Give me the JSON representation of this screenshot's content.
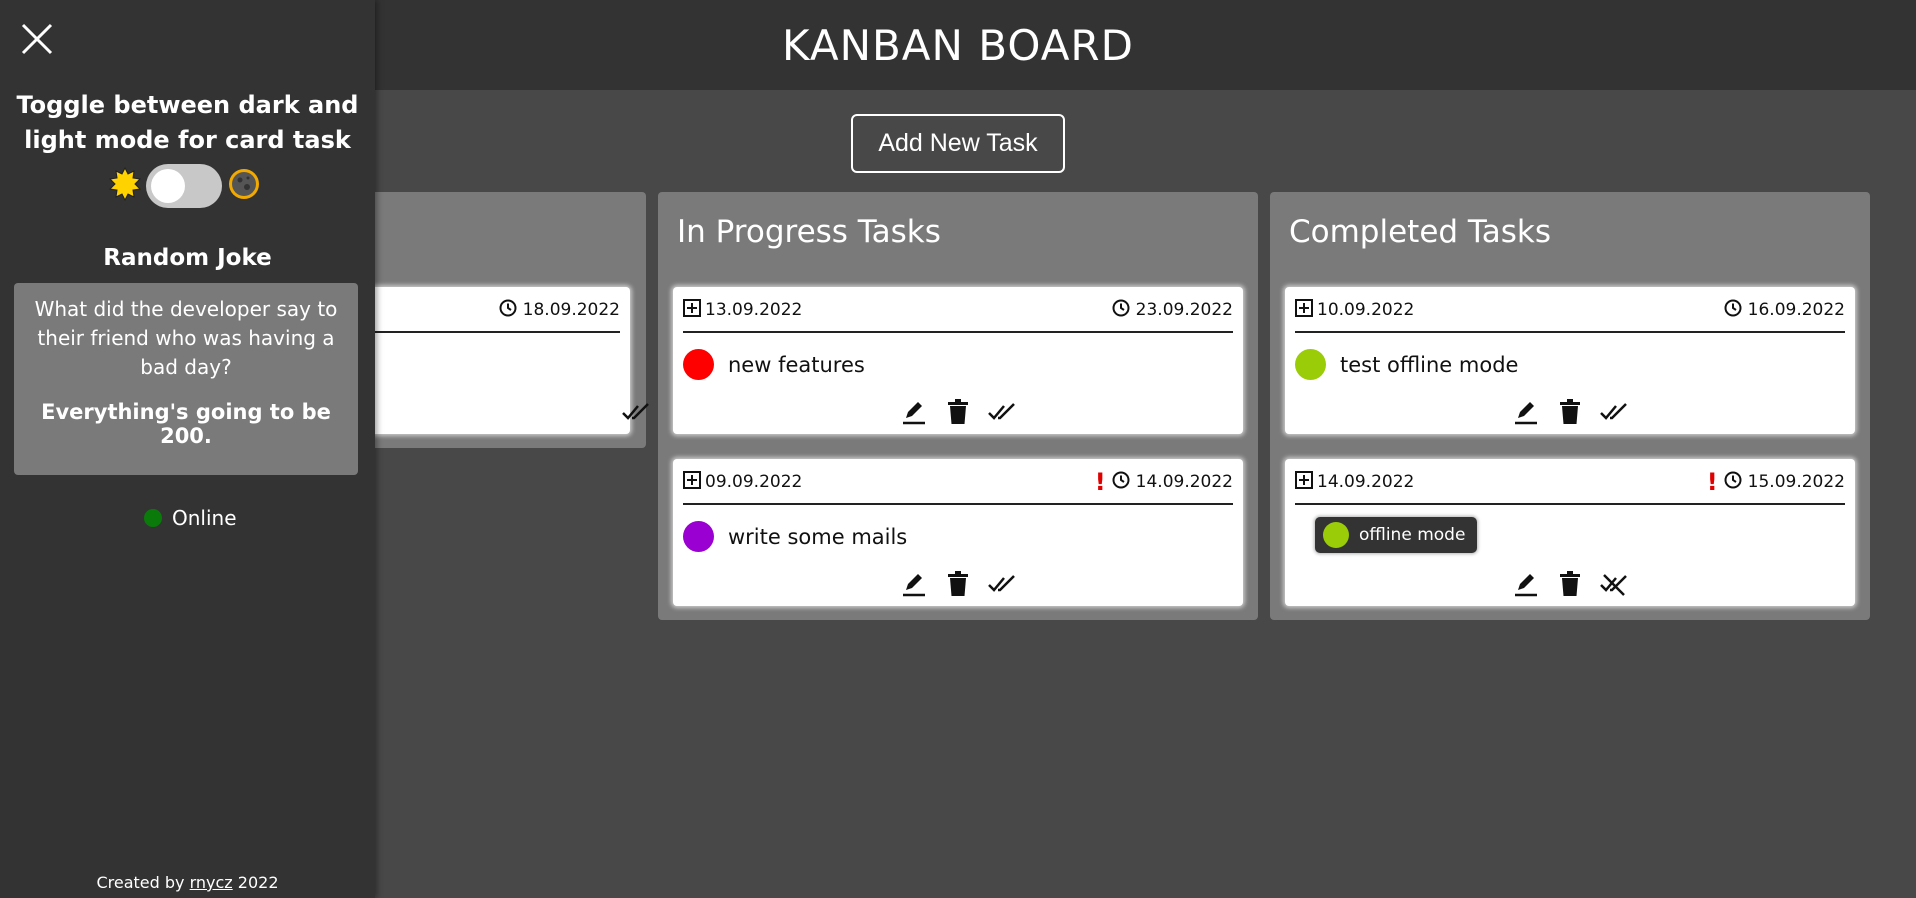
{
  "header": {
    "title": "KANBAN BOARD"
  },
  "add_button": {
    "label": "Add New Task"
  },
  "columns": [
    {
      "title": "",
      "cards": [
        {
          "created": "",
          "due": "18.09.2022",
          "title": "",
          "priority": false,
          "color": ""
        }
      ]
    },
    {
      "title": "In Progress Tasks",
      "cards": [
        {
          "created": "13.09.2022",
          "due": "23.09.2022",
          "title": "new features",
          "priority": false,
          "color": "#ff0000"
        },
        {
          "created": "09.09.2022",
          "due": "14.09.2022",
          "title": "write some mails",
          "priority": true,
          "color": "#9b00d3"
        }
      ]
    },
    {
      "title": "Completed Tasks",
      "cards": [
        {
          "created": "10.09.2022",
          "due": "16.09.2022",
          "title": "test offline mode",
          "priority": false,
          "color": "#9acd07"
        },
        {
          "created": "14.09.2022",
          "due": "15.09.2022",
          "title": "offline mode",
          "priority": true,
          "color": "#9acd07",
          "style": "tag"
        }
      ]
    }
  ],
  "sidebar": {
    "toggle_title": "Toggle between dark and light mode for card task",
    "joke_title": "Random Joke",
    "joke_question": "What did the developer say to their friend who was having a bad day?",
    "joke_answer": "Everything's going to be 200.",
    "status": "Online",
    "footer_prefix": "Created by",
    "footer_author": "rnycz",
    "footer_year": "2022"
  },
  "colors": {
    "header_bg": "#333333",
    "board_bg": "#484848",
    "column_bg": "#7a7a7a",
    "online": "#0a7a0a",
    "priority": "#e00000"
  }
}
